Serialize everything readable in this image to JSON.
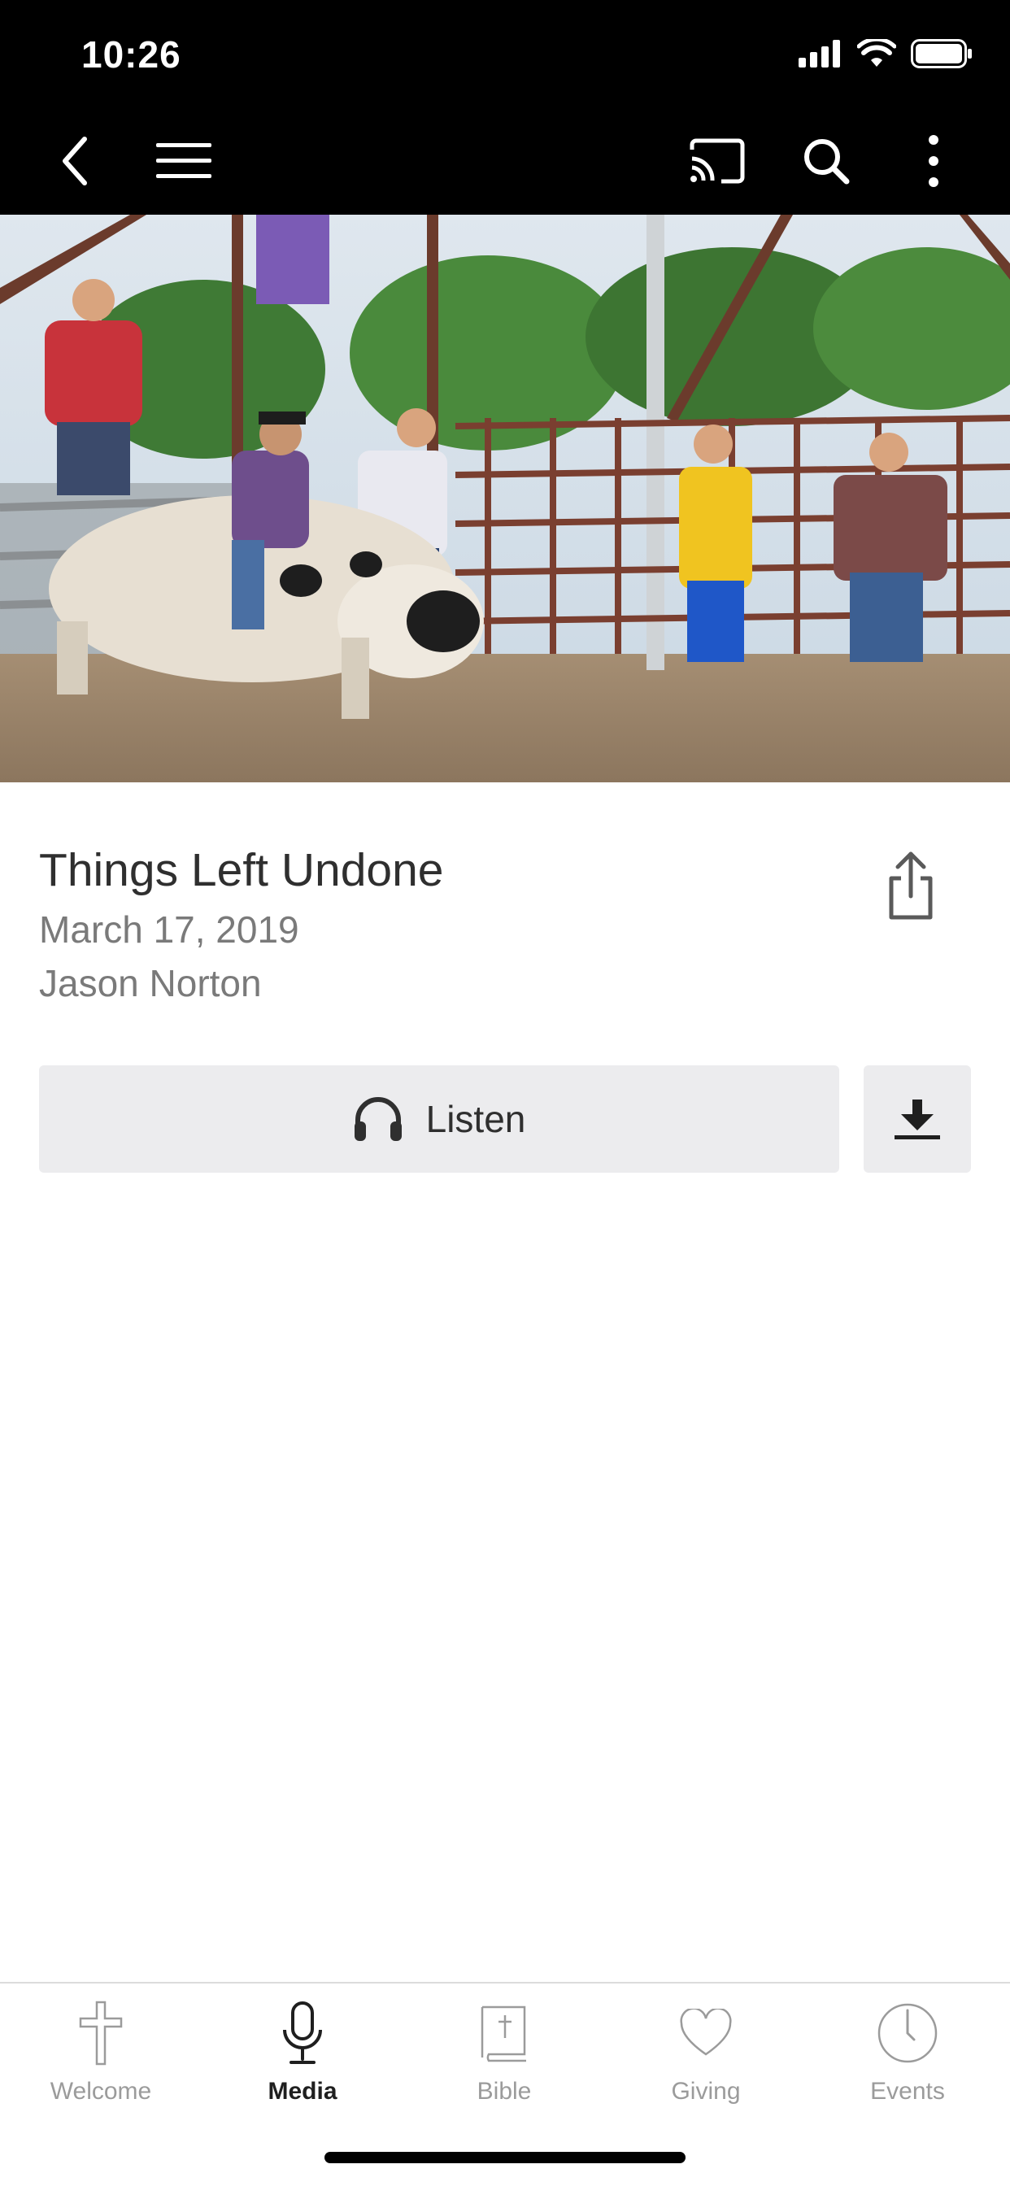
{
  "status_bar": {
    "time": "10:26"
  },
  "nav": {
    "back_icon": "chevron-left-icon",
    "menu_icon": "hamburger-menu-icon",
    "cast_icon": "cast-icon",
    "search_icon": "search-icon",
    "more_icon": "more-vertical-icon"
  },
  "hero": {
    "description_icon": "rodeo-photo"
  },
  "sermon": {
    "title": "Things Left Undone",
    "date": "March 17, 2019",
    "speaker": "Jason Norton"
  },
  "actions": {
    "listen_label": "Listen",
    "listen_icon": "headphones-icon",
    "download_icon": "download-icon",
    "share_icon": "share-icon"
  },
  "tabs": [
    {
      "label": "Welcome",
      "icon": "cross-icon",
      "active": false
    },
    {
      "label": "Media",
      "icon": "microphone-icon",
      "active": true
    },
    {
      "label": "Bible",
      "icon": "bible-icon",
      "active": false
    },
    {
      "label": "Giving",
      "icon": "heart-icon",
      "active": false
    },
    {
      "label": "Events",
      "icon": "clock-icon",
      "active": false
    }
  ],
  "colors": {
    "bar_background": "#000000",
    "button_background": "#ececee",
    "active_tab": "#1f1f1f",
    "inactive_tab": "#9b9b9b"
  }
}
